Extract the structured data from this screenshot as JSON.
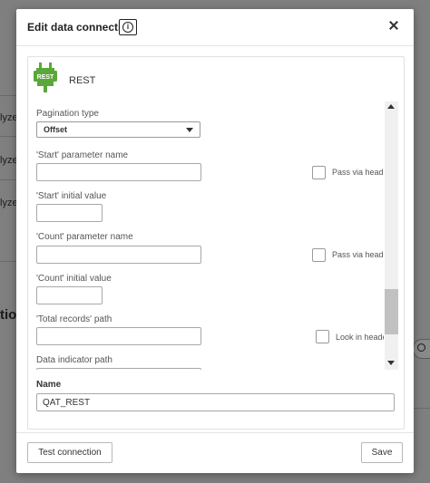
{
  "background": {
    "row_fragment": "lyze",
    "big_fragment": "tion"
  },
  "dialog": {
    "title": "Edit data connection",
    "info_glyph": "i"
  },
  "connector": {
    "logo_text": "REST",
    "name": "REST"
  },
  "fields": {
    "pagination_type_label": "Pagination type",
    "pagination_type_value": "Offset",
    "start_param_label": "'Start' parameter name",
    "start_param_value": "",
    "start_initial_label": "'Start' initial value",
    "start_initial_value": "",
    "count_param_label": "'Count' parameter name",
    "count_param_value": "",
    "count_initial_label": "'Count' initial value",
    "count_initial_value": "",
    "total_records_label": "'Total records' path",
    "total_records_value": "",
    "data_indicator_label": "Data indicator path",
    "data_indicator_value": "",
    "pass_via_header_label": "Pass via header",
    "look_in_header_label": "Look in header"
  },
  "name_section": {
    "label": "Name",
    "value": "QAT_REST"
  },
  "footer": {
    "test_label": "Test connection",
    "save_label": "Save"
  },
  "colors": {
    "logo_green": "#5aa83a",
    "backdrop": "#7f7f7f"
  }
}
